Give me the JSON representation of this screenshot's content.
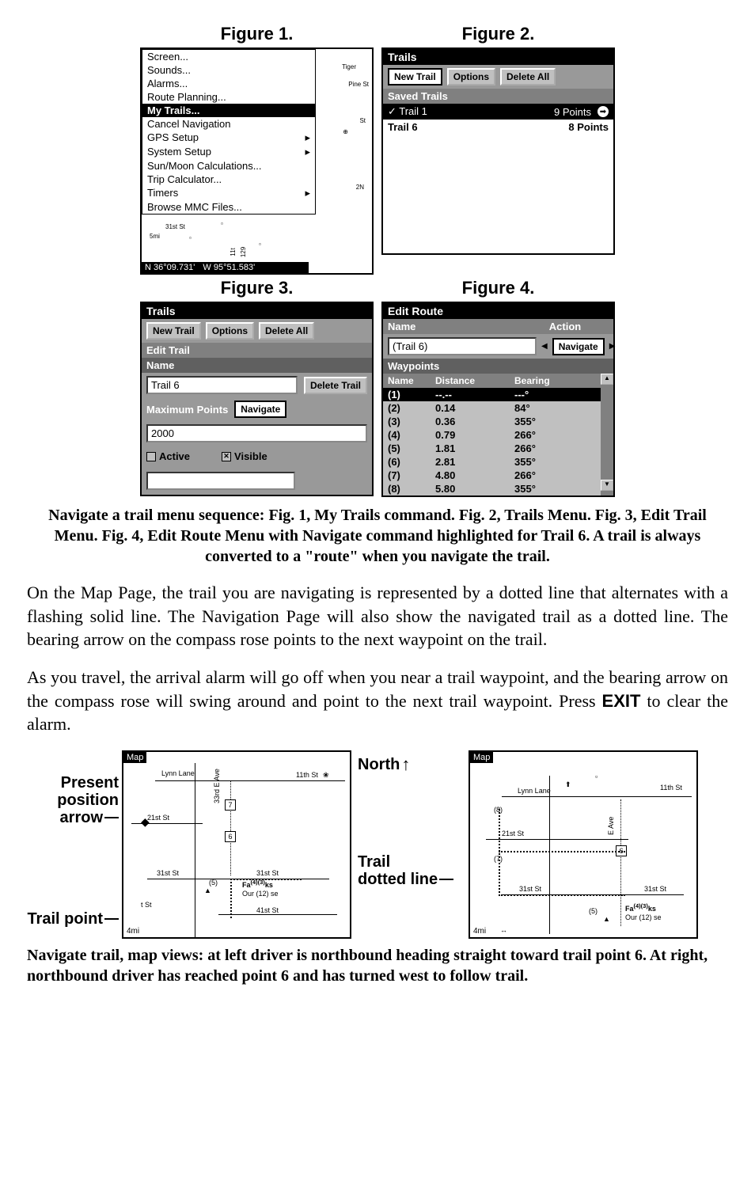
{
  "figures": {
    "fig1": {
      "title": "Figure 1.",
      "menu": {
        "items": [
          {
            "label": "Screen...",
            "sub": false
          },
          {
            "label": "Sounds...",
            "sub": false
          },
          {
            "label": "Alarms...",
            "sub": false
          },
          {
            "label": "Route Planning...",
            "sub": false
          },
          {
            "label": "My Trails...",
            "sub": false,
            "hl": true
          },
          {
            "label": "Cancel Navigation",
            "sub": false
          },
          {
            "label": "GPS Setup",
            "sub": true
          },
          {
            "label": "System Setup",
            "sub": true
          },
          {
            "label": "Sun/Moon Calculations...",
            "sub": false
          },
          {
            "label": "Trip Calculator...",
            "sub": false
          },
          {
            "label": "Timers",
            "sub": true
          },
          {
            "label": "Browse MMC Files...",
            "sub": false
          }
        ]
      },
      "map_label_right": "Pine St",
      "status": {
        "lat": "N  36°09.731'",
        "lon": "W  95°51.583'"
      }
    },
    "fig2": {
      "title": "Figure 2.",
      "titlebar": "Trails",
      "buttons": {
        "new": "New Trail",
        "options": "Options",
        "delete": "Delete All"
      },
      "section": "Saved Trails",
      "rows": [
        {
          "name": "✓ Trail 1",
          "pts": "9 Points",
          "hl": true
        },
        {
          "name": "Trail 6",
          "pts": "8 Points",
          "hl": false
        }
      ]
    },
    "fig3": {
      "title": "Figure 3.",
      "titlebar": "Trails",
      "buttons": {
        "new": "New Trail",
        "options": "Options",
        "delete": "Delete All"
      },
      "edit_section": "Edit Trail",
      "name_label": "Name",
      "name_value": "Trail 6",
      "delete_trail_btn": "Delete Trail",
      "max_label": "Maximum Points",
      "nav_btn": "Navigate",
      "max_value": "2000",
      "active_label": "Active",
      "visible_label": "Visible"
    },
    "fig4": {
      "title": "Figure 4.",
      "titlebar": "Edit Route",
      "name_hdr": "Name",
      "action_hdr": "Action",
      "route_name": "(Trail 6)",
      "nav_btn": "Navigate",
      "wp_section": "Waypoints",
      "cols": {
        "c1": "Name",
        "c2": "Distance",
        "c3": "Bearing"
      },
      "rows": [
        {
          "n": "(1)",
          "d": "--.--",
          "b": "---°",
          "hl": true
        },
        {
          "n": "(2)",
          "d": "0.14",
          "b": "84°"
        },
        {
          "n": "(3)",
          "d": "0.36",
          "b": "355°"
        },
        {
          "n": "(4)",
          "d": "0.79",
          "b": "266°"
        },
        {
          "n": "(5)",
          "d": "1.81",
          "b": "266°"
        },
        {
          "n": "(6)",
          "d": "2.81",
          "b": "355°"
        },
        {
          "n": "(7)",
          "d": "4.80",
          "b": "266°"
        },
        {
          "n": "(8)",
          "d": "5.80",
          "b": "355°"
        }
      ]
    }
  },
  "caption1": "Navigate a trail menu sequence: Fig. 1, My Trails command. Fig. 2, Trails Menu. Fig. 3, Edit Trail Menu. Fig. 4, Edit Route Menu with Navigate command highlighted for Trail 6. A trail is always converted to a \"route\" when you navigate the trail.",
  "para1": "On the Map Page, the trail you are navigating is represented by a dotted line that alternates with a flashing solid line. The Navigation Page will also show the navigated trail as a dotted line. The bearing arrow on the compass rose points to the next waypoint on the trail.",
  "para2_a": "As you travel, the arrival alarm will go off when you near a trail waypoint, and the bearing arrow on the compass rose will swing around and point to the next trail waypoint. Press ",
  "para2_exit": "EXIT",
  "para2_b": " to clear the alarm.",
  "map_labels": {
    "present": "Present",
    "position": "position",
    "arrow": "arrow",
    "trail_point": "Trail point",
    "north": "North ",
    "trail": "Trail",
    "dotted": "dotted line"
  },
  "maps": {
    "title": "Map",
    "left": {
      "streets": {
        "v1": "Lynn Lane",
        "h1": "11th St",
        "h2": "21st St",
        "h3": "31st St",
        "h4": "41st St",
        "v2": "33rd E Ave"
      },
      "wp": {
        "a": "(5)",
        "b": "(6)",
        "c": "(7)"
      },
      "dest": "Fa Our (12) se",
      "scale": "4mi"
    },
    "right": {
      "streets": {
        "v1": "Lynn Lane",
        "h1": "11th St",
        "h2": "21st St",
        "h3": "31st St",
        "v2": "E Ave"
      },
      "wp": {
        "a": "(5)",
        "b": "(6)",
        "c": "(7)",
        "d": "(8)"
      },
      "dest": "Fa Our (12) se",
      "scale": "4mi"
    }
  },
  "caption2": "Navigate trail, map views: at left driver is northbound heading straight toward trail point 6. At right, northbound driver has reached point 6 and has turned west to follow trail."
}
